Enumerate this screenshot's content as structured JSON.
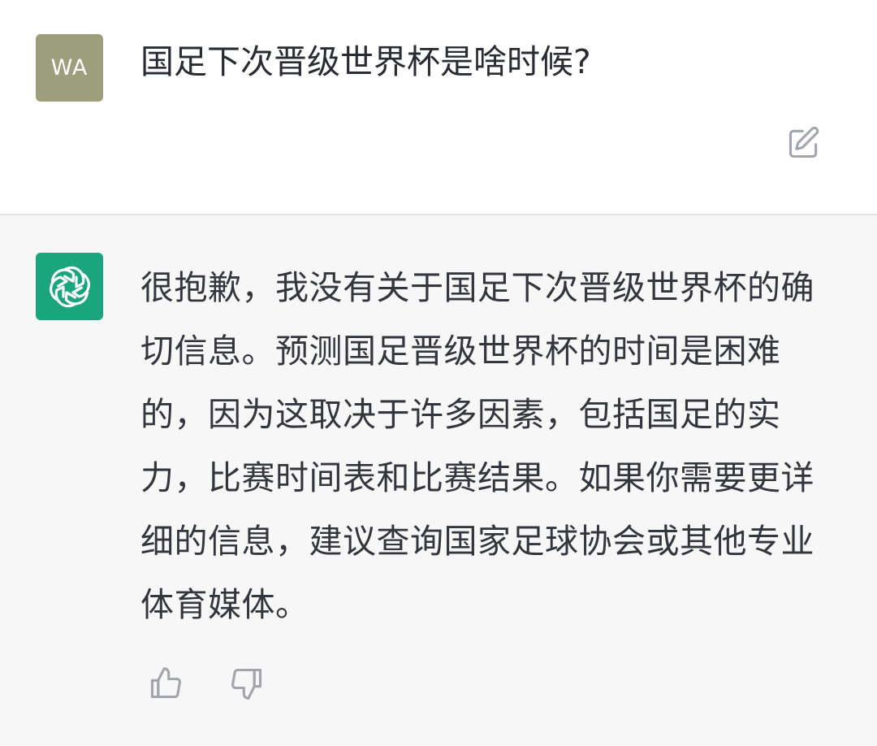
{
  "user_message": {
    "avatar_initials": "WA",
    "avatar_color": "#9c9e7c",
    "text": "国足下次晋级世界杯是啥时候?",
    "edit_icon": "edit-icon"
  },
  "assistant_message": {
    "avatar_icon": "openai-logo-icon",
    "avatar_color": "#1aa57f",
    "text": "很抱歉，我没有关于国足下次晋级世界杯的确切信息。预测国足晋级世界杯的时间是困难的，因为这取决于许多因素，包括国足的实力，比赛时间表和比赛结果。如果你需要更详细的信息，建议查询国家足球协会或其他专业体育媒体。",
    "feedback_icons": [
      "thumbs-up-icon",
      "thumbs-down-icon"
    ]
  }
}
